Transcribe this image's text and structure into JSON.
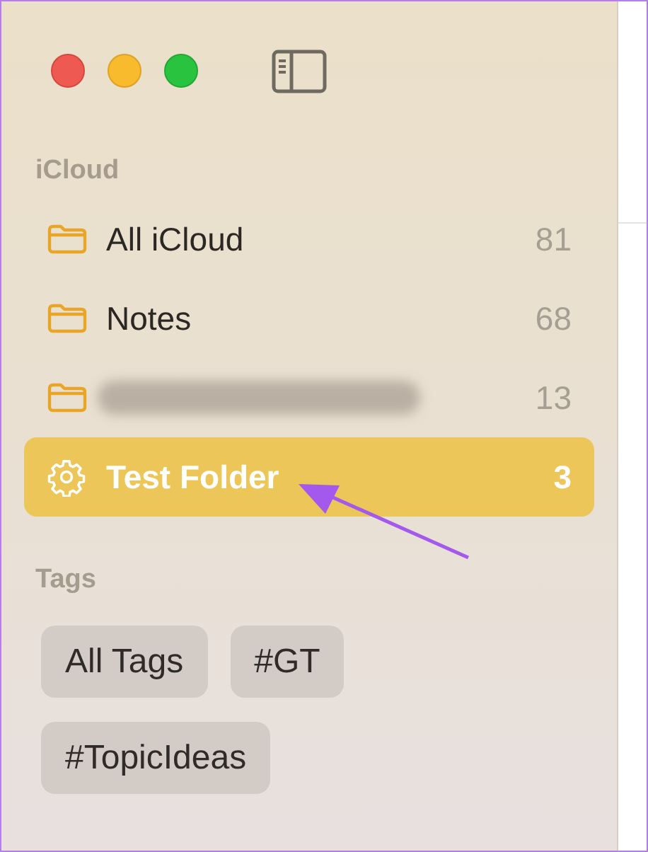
{
  "sections": [
    {
      "title": "iCloud",
      "folders": [
        {
          "kind": "folder",
          "name": "All iCloud",
          "count": "81",
          "selected": false,
          "redacted": false
        },
        {
          "kind": "folder",
          "name": "Notes",
          "count": "68",
          "selected": false,
          "redacted": false
        },
        {
          "kind": "folder",
          "count": "13",
          "selected": false,
          "redacted": true
        },
        {
          "kind": "smart",
          "name": "Test Folder",
          "count": "3",
          "selected": true,
          "redacted": false
        }
      ]
    },
    {
      "title": "Tags",
      "tags": [
        "All Tags",
        "#GT",
        "#TopicIdeas"
      ]
    }
  ]
}
